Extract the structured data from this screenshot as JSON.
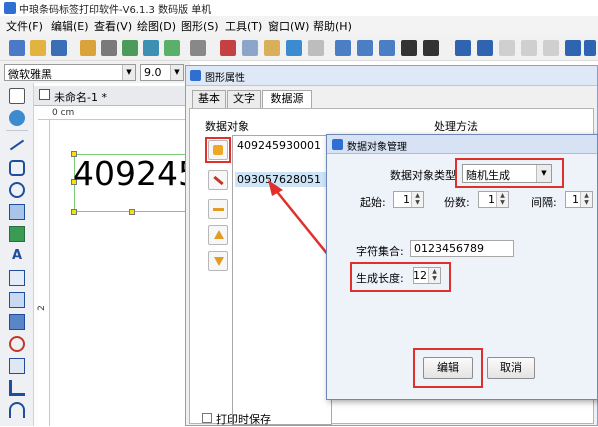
{
  "app": {
    "title": "中琅条码标签打印软件-V6.1.3 数码版 单机"
  },
  "menubar": {
    "items": [
      "文件(F)",
      "编辑(E)",
      "查看(V)",
      "绘图(D)",
      "图形(S)",
      "工具(T)",
      "窗口(W)",
      "帮助(H)"
    ]
  },
  "fontbar": {
    "font_name": "微软雅黑",
    "font_size": "9.0"
  },
  "document": {
    "tab_label": "未命名-1 *",
    "ruler_unit": "0 cm",
    "ruler_mark": "2",
    "barcode_text": "409245"
  },
  "prop_window": {
    "title": "图形属性",
    "tabs": [
      "基本",
      "文字",
      "数据源"
    ],
    "active_tab": 2,
    "data_objects_label": "数据对象",
    "processing_label": "处理方法",
    "items": [
      "409245930001",
      "093057628051"
    ],
    "print_save_label": "打印时保存"
  },
  "dialog": {
    "title": "数据对象管理",
    "type_label": "数据对象类型",
    "type_value": "随机生成",
    "start_label": "起始:",
    "start_value": "1",
    "copies_label": "份数:",
    "copies_value": "1",
    "interval_label": "间隔:",
    "interval_value": "1",
    "charset_label": "字符集合:",
    "charset_value": "0123456789",
    "length_label": "生成长度:",
    "length_value": "12",
    "edit_button": "编辑",
    "cancel_button": "取消"
  },
  "colors": {
    "highlight": "#e0302c",
    "selection": "#cde5f7",
    "accent": "#2f6fd1"
  }
}
